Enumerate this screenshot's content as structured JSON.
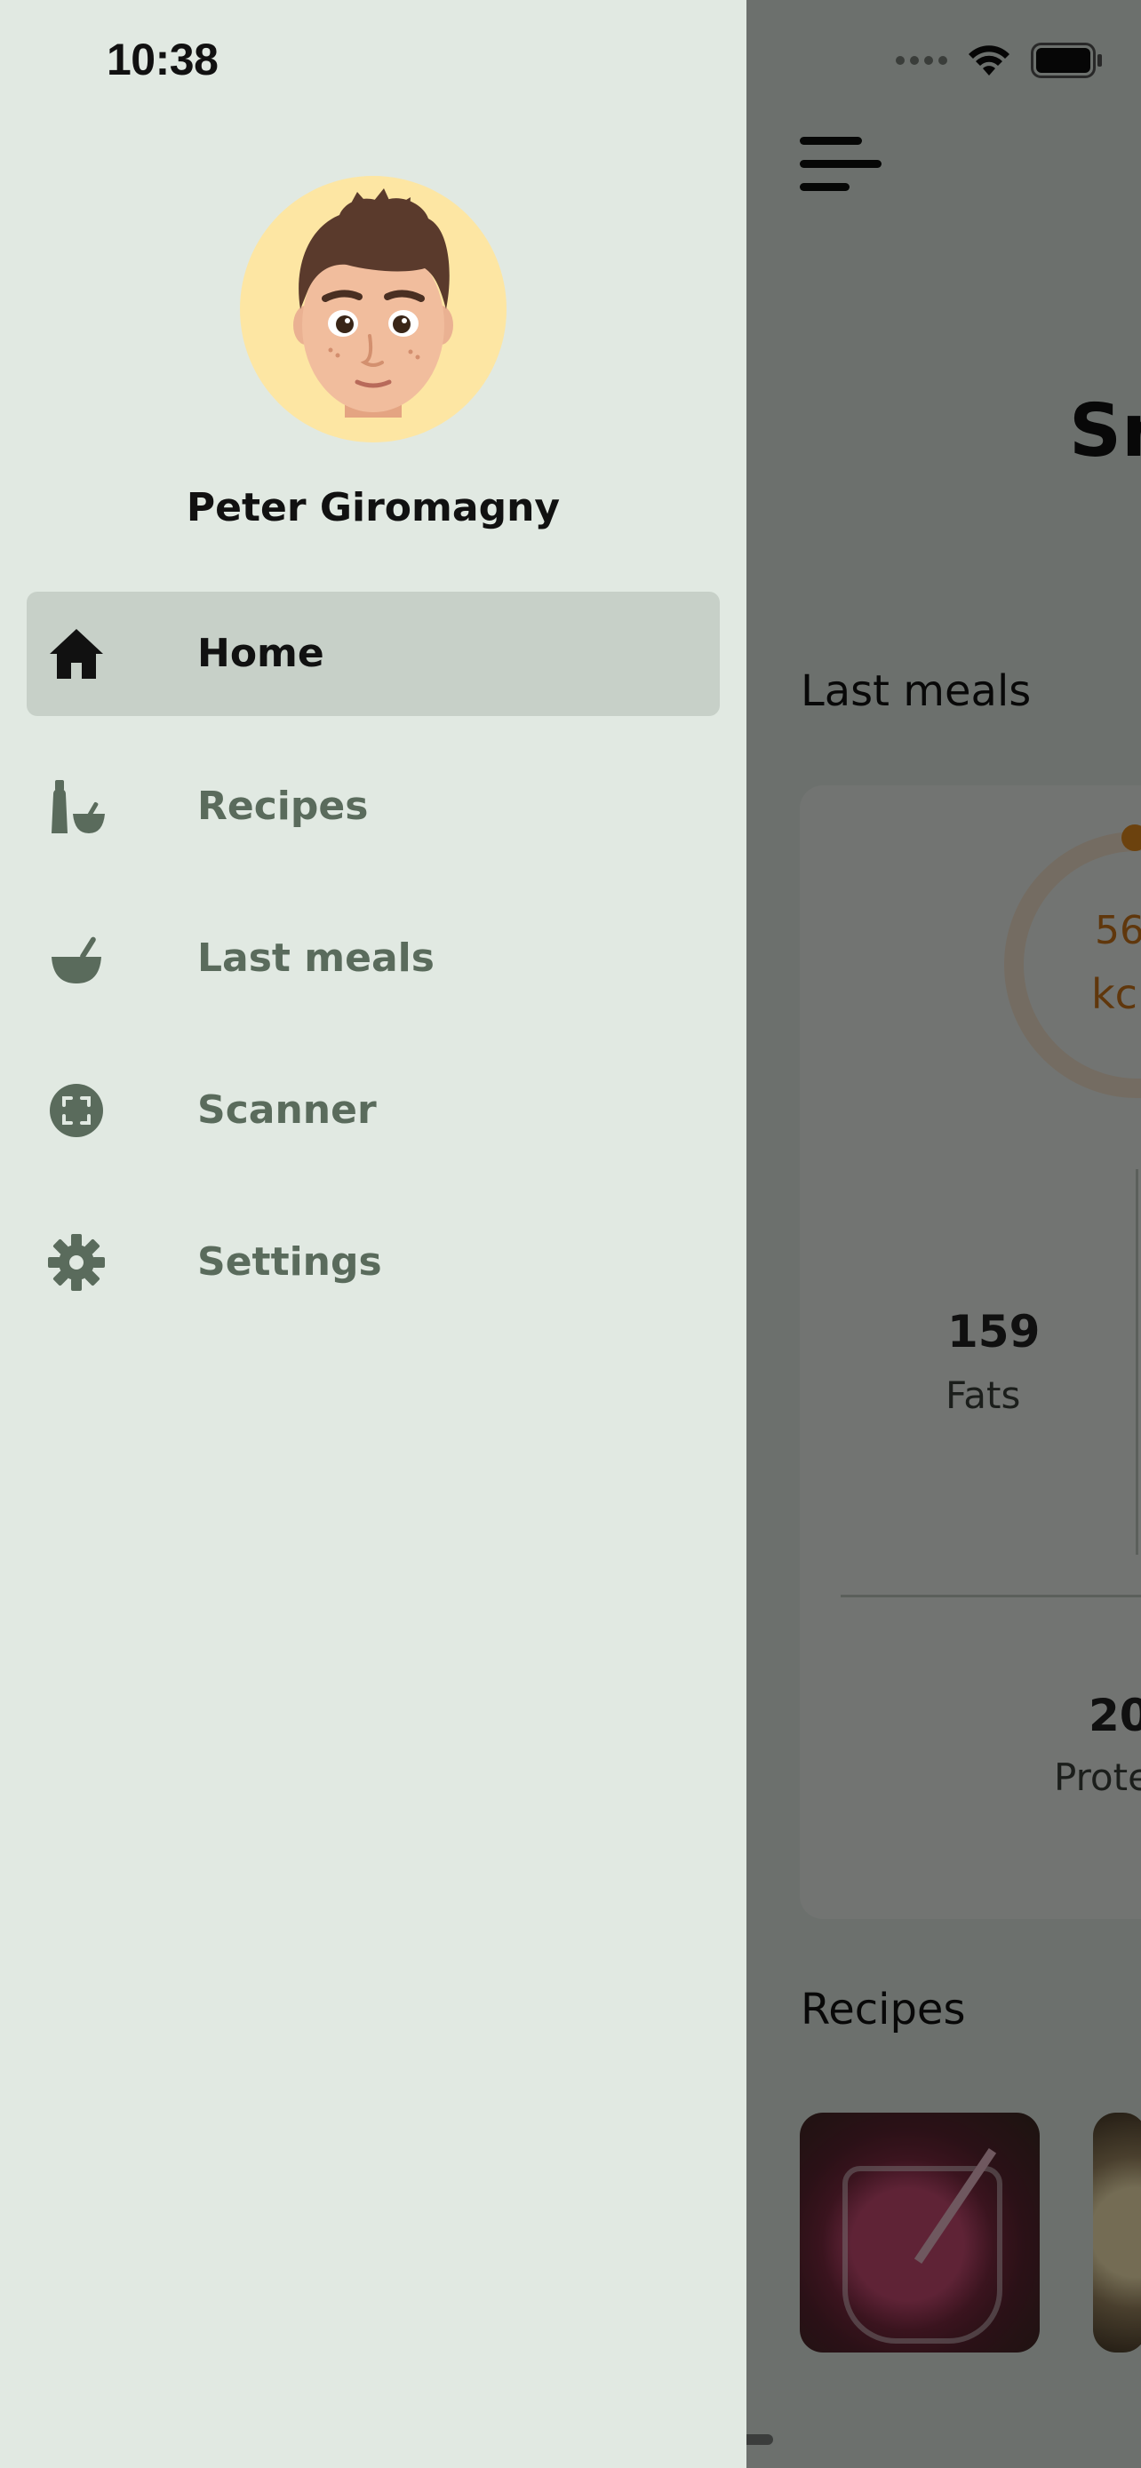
{
  "status_bar": {
    "time": "10:38"
  },
  "drawer": {
    "user_name": "Peter Giromagny",
    "nav": [
      {
        "label": "Home",
        "icon": "home-icon",
        "active": true
      },
      {
        "label": "Recipes",
        "icon": "bottles-icon",
        "active": false
      },
      {
        "label": "Last meals",
        "icon": "bowl-icon",
        "active": false
      },
      {
        "label": "Scanner",
        "icon": "scanner-icon",
        "active": false
      },
      {
        "label": "Settings",
        "icon": "gear-icon",
        "active": false
      }
    ]
  },
  "main": {
    "title_fragment": "Sr",
    "last_meals_title": "Last meals",
    "kcal_value": "56",
    "kcal_unit": "kc",
    "stats": {
      "fats_value": "159",
      "fats_label": "Fats",
      "protein_value": "20",
      "protein_label": "Prote"
    },
    "recipes_title": "Recipes"
  },
  "colors": {
    "drawer_bg": "#e1e9e2",
    "active_item_bg": "#c7d0c8",
    "inactive_text": "#5a6b5c",
    "accent_orange": "#e18a1e",
    "avatar_bg": "#fde6a3"
  }
}
